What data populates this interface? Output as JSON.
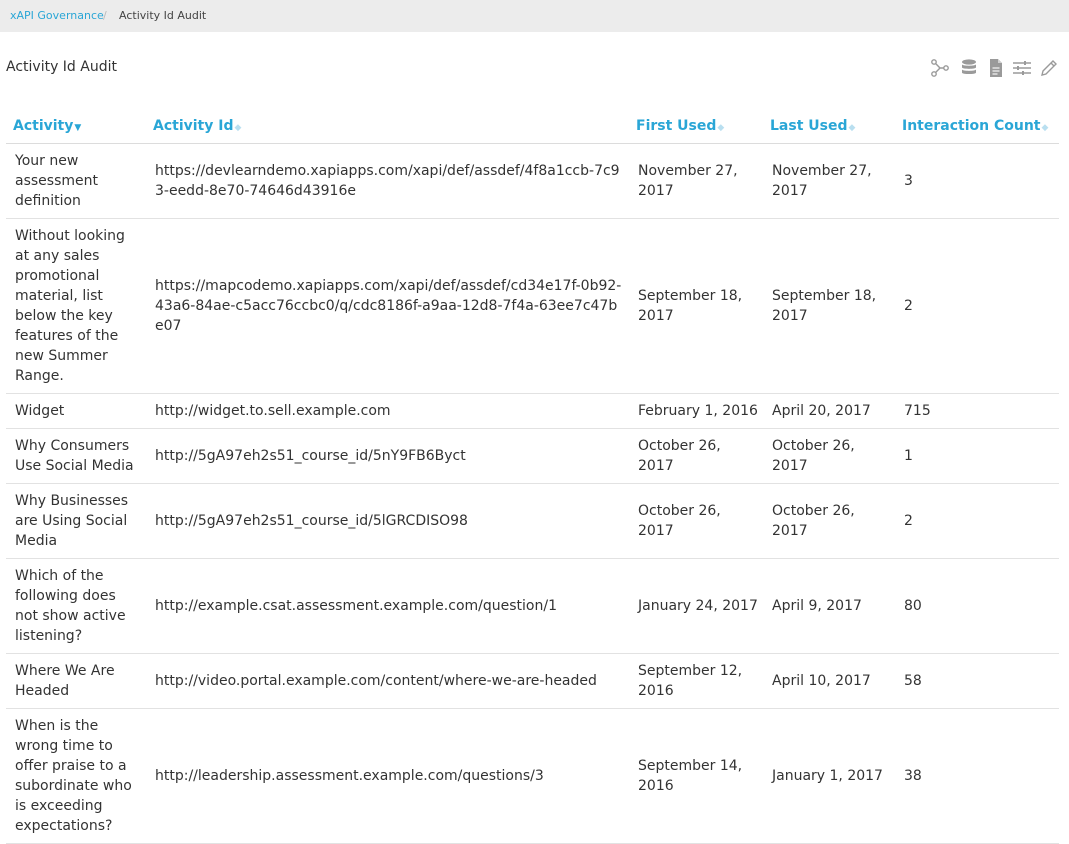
{
  "breadcrumb": {
    "parent": "xAPI Governance",
    "separator": "/",
    "current": "Activity Id Audit"
  },
  "page": {
    "title": "Activity Id Audit"
  },
  "toolbar": {
    "icons": [
      "share-graph-icon",
      "database-icon",
      "document-icon",
      "settings-sliders-icon",
      "pencil-icon"
    ],
    "icon_color": "#9a9a9a"
  },
  "colors": {
    "accent": "#2aa6d6",
    "breadcrumb_bg": "#ececec"
  },
  "table": {
    "columns": [
      {
        "label": "Activity",
        "sorted": true
      },
      {
        "label": "Activity Id",
        "sorted": false
      },
      {
        "label": "First Used",
        "sorted": false
      },
      {
        "label": "Last Used",
        "sorted": false
      },
      {
        "label": "Interaction Count",
        "sorted": false
      }
    ],
    "rows": [
      {
        "activity": "Your new assessment definition",
        "activity_id": "https://devlearndemo.xapiapps.com/xapi/def/assdef/4f8a1ccb-7c93-eedd-8e70-74646d43916e",
        "first_used": "November 27, 2017",
        "last_used": "November 27, 2017",
        "count": "3"
      },
      {
        "activity": "Without looking at any sales promotional material, list below the key features of the new Summer Range.",
        "activity_id": "https://mapcodemo.xapiapps.com/xapi/def/assdef/cd34e17f-0b92-43a6-84ae-c5acc76ccbc0/q/cdc8186f-a9aa-12d8-7f4a-63ee7c47be07",
        "first_used": "September 18, 2017",
        "last_used": "September 18, 2017",
        "count": "2"
      },
      {
        "activity": "Widget",
        "activity_id": "http://widget.to.sell.example.com",
        "first_used": "February 1, 2016",
        "last_used": "April 20, 2017",
        "count": "715"
      },
      {
        "activity": "Why Consumers Use Social Media",
        "activity_id": "http://5gA97eh2s51_course_id/5nY9FB6Byct",
        "first_used": "October 26, 2017",
        "last_used": "October 26, 2017",
        "count": "1"
      },
      {
        "activity": "Why Businesses are Using Social Media",
        "activity_id": "http://5gA97eh2s51_course_id/5lGRCDISO98",
        "first_used": "October 26, 2017",
        "last_used": "October 26, 2017",
        "count": "2"
      },
      {
        "activity": "Which of the following does not show active listening?",
        "activity_id": "http://example.csat.assessment.example.com/question/1",
        "first_used": "January 24, 2017",
        "last_used": "April 9, 2017",
        "count": "80"
      },
      {
        "activity": "Where We Are Headed",
        "activity_id": "http://video.portal.example.com/content/where-we-are-headed",
        "first_used": "September 12, 2016",
        "last_used": "April 10, 2017",
        "count": "58"
      },
      {
        "activity": "When is the wrong time to offer praise to a subordinate who is exceeding expectations?",
        "activity_id": "http://leadership.assessment.example.com/questions/3",
        "first_used": "September 14, 2016",
        "last_used": "January 1, 2017",
        "count": "38"
      }
    ]
  }
}
